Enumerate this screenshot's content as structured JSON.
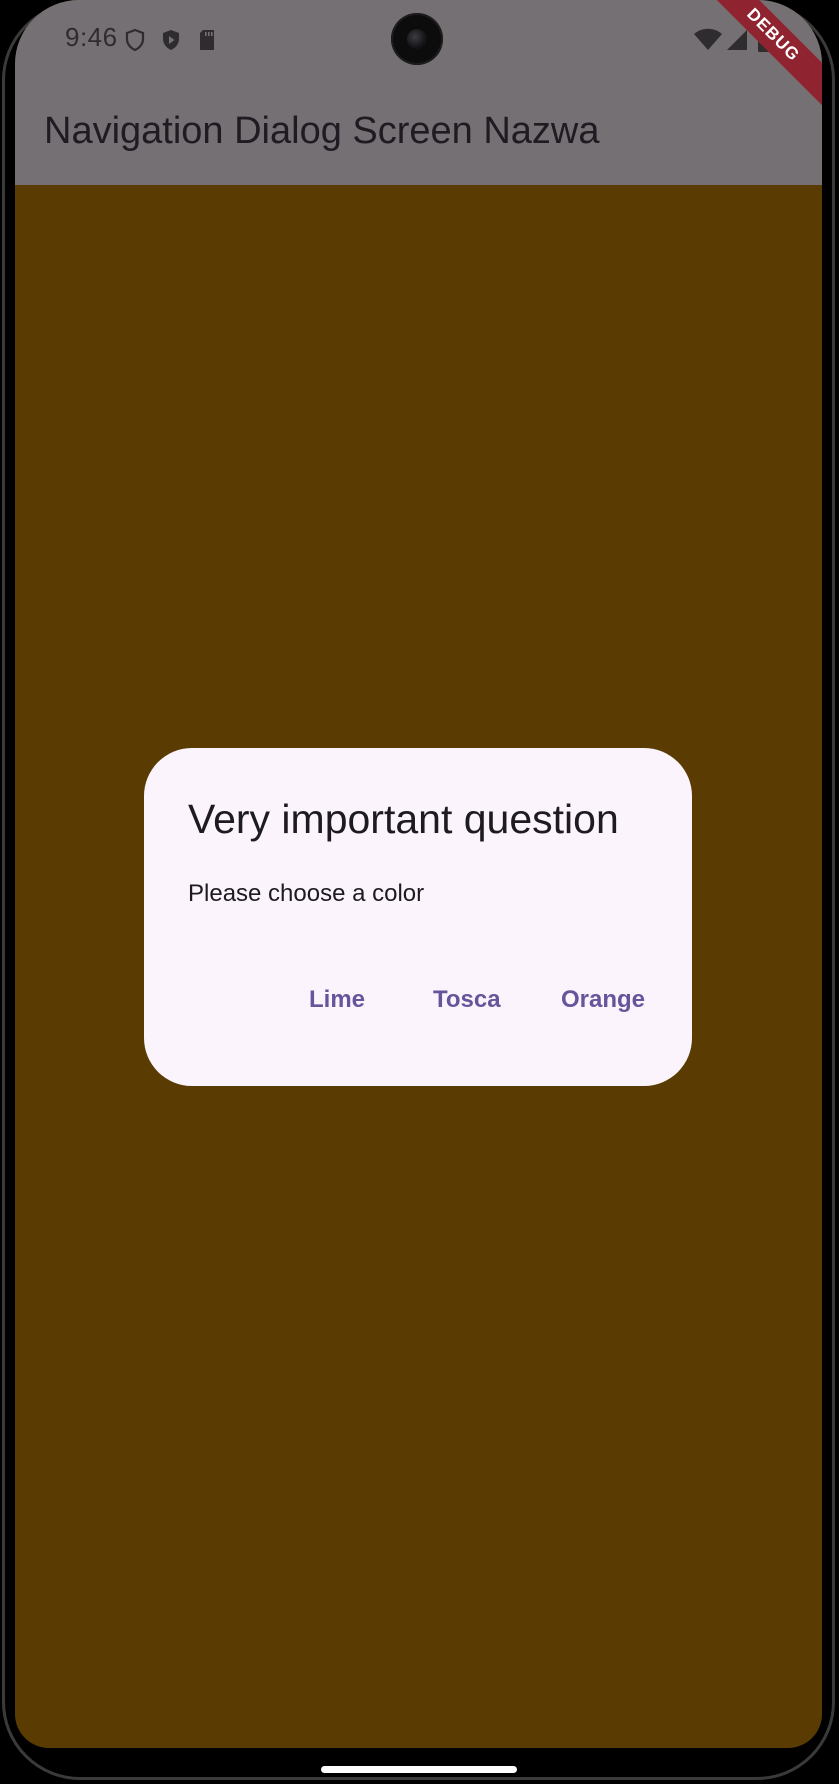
{
  "status_bar": {
    "time": "9:46",
    "left_icons": [
      "shield-icon",
      "play-protect-icon",
      "sd-card-icon"
    ],
    "right_icons": [
      "wifi-icon",
      "cell-signal-icon",
      "battery-icon"
    ]
  },
  "app_bar": {
    "title": "Navigation Dialog Screen Nazwa",
    "background": "#757074"
  },
  "debug_banner": {
    "label": "DEBUG",
    "color": "#8f2430"
  },
  "body": {
    "background": "#5a3c02"
  },
  "dialog": {
    "title": "Very important question",
    "content": "Please choose a color",
    "background": "#fbf4fc",
    "actions": [
      {
        "label": "Lime"
      },
      {
        "label": "Tosca"
      },
      {
        "label": "Orange"
      }
    ],
    "action_color": "#65559b"
  }
}
